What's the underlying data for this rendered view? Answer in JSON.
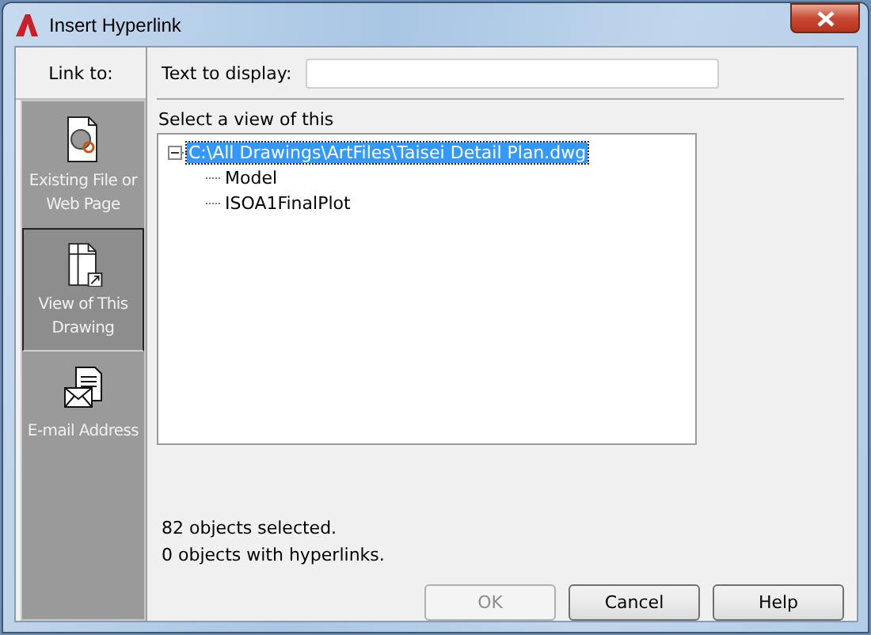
{
  "window": {
    "title": "Insert Hyperlink"
  },
  "sidebar": {
    "heading": "Link to:",
    "items": [
      {
        "label": "Existing File or Web Page",
        "kind": "file",
        "selected": false
      },
      {
        "label": "View of This Drawing",
        "kind": "view",
        "selected": true
      },
      {
        "label": "E-mail Address",
        "kind": "email",
        "selected": false
      }
    ]
  },
  "text_to_display": {
    "label": "Text to display:"
  },
  "tree": {
    "label": "Select a view of this",
    "items": [
      {
        "label": "C:\\All Drawings\\ArtFiles\\Taisei Detail Plan.dwg",
        "selected": true,
        "expanded": true,
        "children": [
          {
            "label": "Model",
            "selected": false
          },
          {
            "label": "ISOA1FinalPlot",
            "selected": false
          }
        ]
      }
    ]
  },
  "status": [
    "82 objects selected.",
    "0 objects with hyperlinks."
  ],
  "buttons": [
    {
      "label": "OK",
      "disabled": true
    },
    {
      "label": "Cancel",
      "disabled": false
    },
    {
      "label": "Help",
      "disabled": false
    }
  ]
}
